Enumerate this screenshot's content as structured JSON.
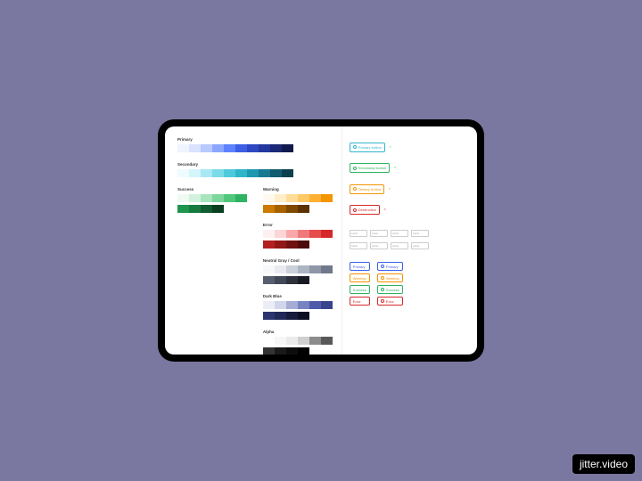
{
  "watermark": "jitter.video",
  "palettes": {
    "primary": {
      "label": "Primary",
      "colors": [
        "#f0f4ff",
        "#d9e2ff",
        "#b8c9ff",
        "#8ba6ff",
        "#5e82ff",
        "#3d5fe6",
        "#2e48c2",
        "#23379e",
        "#1a2875",
        "#111a4d"
      ]
    },
    "secondary": {
      "label": "Secondary",
      "colors": [
        "#eefcff",
        "#d4f5fb",
        "#a8e9f3",
        "#7cdbe9",
        "#50c9db",
        "#2fb5c9",
        "#1f98b0",
        "#177a91",
        "#115c70",
        "#0a3f4d"
      ]
    },
    "success": {
      "label": "Success",
      "colors": [
        "#eefaf2",
        "#d3f2de",
        "#a8e5bd",
        "#7cd79c",
        "#50c77c",
        "#2fb362",
        "#1f964f",
        "#177a3f",
        "#115c30",
        "#0a3f21"
      ]
    },
    "warning": {
      "label": "Warning",
      "colors": [
        "#fff9ee",
        "#ffeec9",
        "#ffdd99",
        "#ffc966",
        "#ffb033",
        "#f29500",
        "#cc7a00",
        "#a66100",
        "#804900",
        "#5c3300"
      ]
    },
    "error": {
      "label": "Error",
      "colors": [
        "#fef0f0",
        "#fcd6d6",
        "#f8a8a8",
        "#f07a7a",
        "#e64d4d",
        "#d62828",
        "#b31f1f",
        "#911717",
        "#701010",
        "#4d0a0a"
      ]
    },
    "neutralCool": {
      "label": "Neutral Gray / Cool",
      "colors": [
        "#f7f8fa",
        "#e9ebf0",
        "#cbd0da",
        "#adb4c2",
        "#8e96a8",
        "#70788c",
        "#575e70",
        "#424857",
        "#2e323d",
        "#1a1c24"
      ]
    },
    "darkBlue": {
      "label": "Dark Blue",
      "colors": [
        "#eceef7",
        "#d2d6ea",
        "#a5add5",
        "#7884c0",
        "#4e5ba8",
        "#37448c",
        "#2a3570",
        "#1f2857",
        "#151b3d",
        "#0c0f24"
      ]
    },
    "alpha": {
      "label": "Alpha",
      "colors": [
        "#ffffff",
        "#f7f7f7",
        "#ebebeb",
        "#cfcfcf",
        "#8c8c8c",
        "#595959",
        "#333333",
        "#1a1a1a",
        "#0d0d0d",
        "#000000"
      ]
    }
  },
  "buttons": [
    {
      "label": "Primary button",
      "color": "#2fb5c9",
      "border": "#2fb5c9"
    },
    {
      "label": "Secondary button",
      "color": "#2fb362",
      "border": "#2fb362"
    },
    {
      "label": "Tertiary button",
      "color": "#f29500",
      "border": "#f29500"
    },
    {
      "label": "Destructive",
      "color": "#d62828",
      "border": "#d62828"
    }
  ],
  "inputs": {
    "placeholder": "Label"
  },
  "badges": [
    {
      "label": "Primary",
      "color": "#3d5fe6"
    },
    {
      "label": "Warning",
      "color": "#f29500"
    },
    {
      "label": "Success",
      "color": "#2fb362"
    },
    {
      "label": "Error",
      "color": "#d62828"
    }
  ]
}
